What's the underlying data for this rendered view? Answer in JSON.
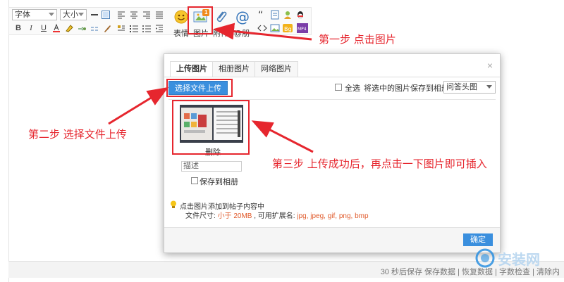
{
  "toolbar": {
    "font_select": "字体",
    "size_select": "大小",
    "bold": "B",
    "italic": "I",
    "underline": "U",
    "emoji_label": "表情",
    "image_label": "图片",
    "image_badge": "1",
    "attach_label": "附件",
    "at_label": "@朋",
    "bg_label": "Bg",
    "media_label": "MP4"
  },
  "dialog": {
    "tabs": [
      "上传图片",
      "相册图片",
      "网络图片"
    ],
    "close": "×",
    "upload_button": "选择文件上传",
    "select_all": "全选",
    "save_to_album_text": "将选中的图片保存到相册:",
    "album_value": "问答头图",
    "delete_label": "删除",
    "desc_placeholder": "描述",
    "save_checkbox_label": "保存到相册",
    "tip_line1": "点击图片添加到帖子内容中",
    "tip_line2_prefix": "文件尺寸: ",
    "tip_size": "小于 20MB",
    "tip_ext_prefix": " , 可用扩展名: ",
    "tip_exts": "jpg, jpeg, gif, png, bmp",
    "ok_button": "确定"
  },
  "statusbar": {
    "autosave": "30 秒后保存 保存数据",
    "restore": "恢复数据",
    "check": "字数检查",
    "clear": "清除内"
  },
  "annotations": {
    "step1": "第一步 点击图片",
    "step2": "第二步 选择文件上传",
    "step3": "第三步 上传成功后，再点击一下图片即可插入"
  },
  "watermark": "安装网",
  "colors": {
    "accent_blue": "#3a8fde",
    "annotation_red": "#e6262e",
    "tip_orange": "#e05a2b"
  }
}
